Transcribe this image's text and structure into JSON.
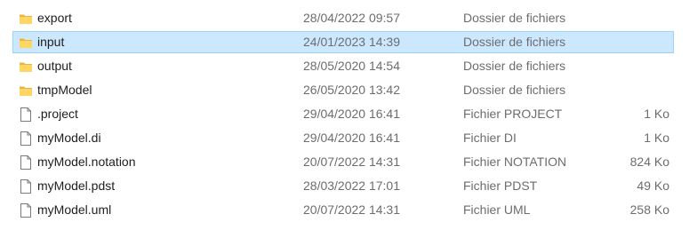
{
  "files": [
    {
      "name": "export",
      "date": "28/04/2022 09:57",
      "type": "Dossier de fichiers",
      "size": "",
      "icon": "folder-icon",
      "selected": false
    },
    {
      "name": "input",
      "date": "24/01/2023 14:39",
      "type": "Dossier de fichiers",
      "size": "",
      "icon": "folder-icon",
      "selected": true
    },
    {
      "name": "output",
      "date": "28/05/2020 14:54",
      "type": "Dossier de fichiers",
      "size": "",
      "icon": "folder-icon",
      "selected": false
    },
    {
      "name": "tmpModel",
      "date": "26/05/2020 13:42",
      "type": "Dossier de fichiers",
      "size": "",
      "icon": "folder-icon",
      "selected": false
    },
    {
      "name": ".project",
      "date": "29/04/2020 16:41",
      "type": "Fichier PROJECT",
      "size": "1 Ko",
      "icon": "file-icon",
      "selected": false
    },
    {
      "name": "myModel.di",
      "date": "29/04/2020 16:41",
      "type": "Fichier DI",
      "size": "1 Ko",
      "icon": "file-icon",
      "selected": false
    },
    {
      "name": "myModel.notation",
      "date": "20/07/2022 14:31",
      "type": "Fichier NOTATION",
      "size": "824 Ko",
      "icon": "file-icon",
      "selected": false
    },
    {
      "name": "myModel.pdst",
      "date": "28/03/2022 17:01",
      "type": "Fichier PDST",
      "size": "49 Ko",
      "icon": "file-icon",
      "selected": false
    },
    {
      "name": "myModel.uml",
      "date": "20/07/2022 14:31",
      "type": "Fichier UML",
      "size": "258 Ko",
      "icon": "file-icon",
      "selected": false
    }
  ],
  "colors": {
    "selection_bg": "#cce8ff",
    "selection_border": "#99d1ff",
    "folder": "#ffd664",
    "folder_dark": "#e8b640",
    "secondary_text": "#6d6d6d"
  }
}
